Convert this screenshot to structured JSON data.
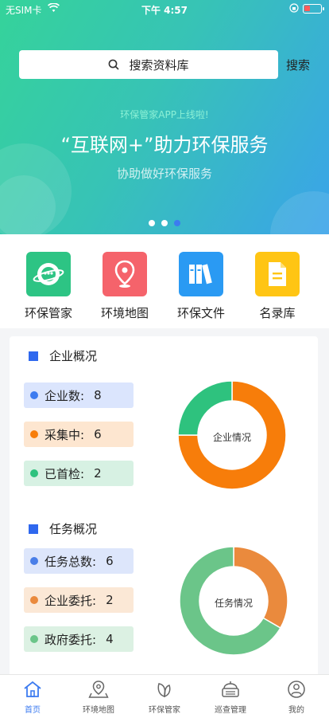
{
  "status_bar": {
    "carrier": "无SIM卡",
    "time": "下午 4:57"
  },
  "search": {
    "placeholder": "搜索资料库",
    "button_label": "搜索"
  },
  "banner": {
    "announcement": "环保管家APP上线啦!",
    "slogan": "“互联网+”助力环保服务",
    "sub_slogan": "协助做好环保服务",
    "dots": 3,
    "active_dot": 2
  },
  "quick_actions": [
    {
      "label": "环保管家",
      "icon": "planet-chat-icon",
      "color": "#2dc484"
    },
    {
      "label": "环境地图",
      "icon": "map-pin-icon",
      "color": "#f5636b"
    },
    {
      "label": "环保文件",
      "icon": "books-icon",
      "color": "#2a9af3"
    },
    {
      "label": "名录库",
      "icon": "document-icon",
      "color": "#ffc514"
    }
  ],
  "enterprise": {
    "title": "企业概况",
    "stats": [
      {
        "label": "企业数:",
        "value": "8",
        "color": "#3c7bf0",
        "bg": "#dbe5fd"
      },
      {
        "label": "采集中:",
        "value": "6",
        "color": "#f77d0a",
        "bg": "#fde6d0"
      },
      {
        "label": "已首检:",
        "value": "2",
        "color": "#2ec27e",
        "bg": "#d7f1e3"
      }
    ],
    "chart_label": "企业情况"
  },
  "tasks": {
    "title": "任务概况",
    "stats": [
      {
        "label": "任务总数:",
        "value": "6",
        "color": "#4a7fe8",
        "bg": "#dde6fb"
      },
      {
        "label": "企业委托:",
        "value": "2",
        "color": "#ea8a3d",
        "bg": "#fbe8d6"
      },
      {
        "label": "政府委托:",
        "value": "4",
        "color": "#6bc589",
        "bg": "#dcf1e3"
      }
    ],
    "chart_label": "任务情况"
  },
  "chart_data": [
    {
      "type": "pie",
      "title": "企业情况",
      "series": [
        {
          "values": [
            6,
            2
          ],
          "colors": [
            "#f77d0a",
            "#2ec27e"
          ]
        }
      ]
    },
    {
      "type": "pie",
      "title": "任务情况",
      "series": [
        {
          "values": [
            2,
            4
          ],
          "colors": [
            "#ea8a3d",
            "#6bc589"
          ]
        }
      ]
    }
  ],
  "tabbar": [
    {
      "label": "首页",
      "icon": "home-icon",
      "active": true
    },
    {
      "label": "环境地图",
      "icon": "map-pin-icon",
      "active": false
    },
    {
      "label": "环保管家",
      "icon": "leaf-icon",
      "active": false
    },
    {
      "label": "巡查管理",
      "icon": "patrol-icon",
      "active": false
    },
    {
      "label": "我的",
      "icon": "user-icon",
      "active": false
    }
  ]
}
